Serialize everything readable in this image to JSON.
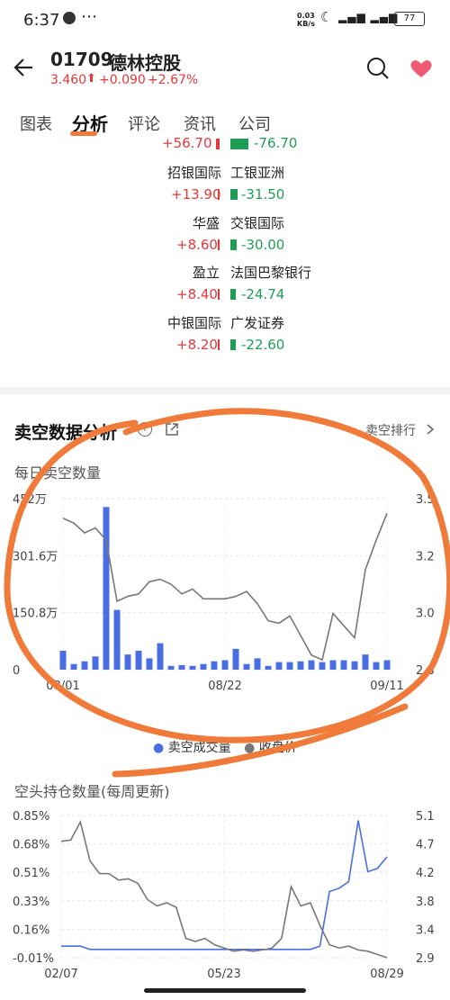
{
  "status_bar": {
    "time": "6:37",
    "net_speed": "0.03\nKB/s",
    "battery": "77"
  },
  "header": {
    "code": "01709",
    "name": "德林控股",
    "price": "3.460",
    "change": "+0.090",
    "change_pct": "+2.67%"
  },
  "tabs": [
    "图表",
    "分析",
    "评论",
    "资讯",
    "公司"
  ],
  "brokers": [
    {
      "buy_name": "",
      "buy_val": "+56.70",
      "sell_name": "",
      "sell_val": "-76.70"
    },
    {
      "buy_name": "招银国际",
      "buy_val": "+13.90",
      "sell_name": "工银亚洲",
      "sell_val": "-31.50"
    },
    {
      "buy_name": "华盛",
      "buy_val": "+8.60",
      "sell_name": "交银国际",
      "sell_val": "-30.00"
    },
    {
      "buy_name": "盈立",
      "buy_val": "+8.40",
      "sell_name": "法国巴黎银行",
      "sell_val": "-24.74"
    },
    {
      "buy_name": "中银国际",
      "buy_val": "+8.20",
      "sell_name": "广发证券",
      "sell_val": "-22.60"
    }
  ],
  "short_section": {
    "title": "卖空数据分析",
    "rank_link": "卖空排行",
    "subtitle": "每日卖空数量"
  },
  "position_section": {
    "subtitle": "空头持仓数量(每周更新)"
  },
  "chart_data": [
    {
      "type": "bar",
      "title": "每日卖空数量",
      "left_ticks": [
        "452万",
        "301.6万",
        "150.8万",
        "0"
      ],
      "right_ticks": [
        "3.5",
        "3.2",
        "3.0",
        "2.8"
      ],
      "x_ticks": [
        "08/01",
        "08/22",
        "09/11"
      ],
      "ylim": [
        0,
        452
      ],
      "y2lim": [
        2.8,
        3.5
      ],
      "series": [
        {
          "name": "卖空成交量",
          "color": "#4a6fe3",
          "values": [
            50,
            15,
            22,
            35,
            430,
            158,
            40,
            50,
            30,
            70,
            10,
            12,
            10,
            15,
            22,
            25,
            55,
            15,
            30,
            10,
            20,
            20,
            22,
            25,
            20,
            25,
            25,
            22,
            40,
            20,
            25
          ]
        },
        {
          "name": "收盘价",
          "color": "#777777",
          "values": [
            3.42,
            3.4,
            3.36,
            3.38,
            3.33,
            3.08,
            3.1,
            3.11,
            3.16,
            3.17,
            3.15,
            3.11,
            3.13,
            3.09,
            3.09,
            3.09,
            3.1,
            3.12,
            3.07,
            3.0,
            2.99,
            3.02,
            2.94,
            2.86,
            2.84,
            3.03,
            2.98,
            2.93,
            3.21,
            3.33,
            3.44
          ]
        }
      ]
    },
    {
      "type": "line",
      "title": "空头持仓数量(每周更新)",
      "left_ticks": [
        "0.85%",
        "0.68%",
        "0.51%",
        "0.33%",
        "0.16%",
        "-0.01%"
      ],
      "right_ticks": [
        "5.1",
        "4.7",
        "4.2",
        "3.8",
        "3.4",
        "2.9"
      ],
      "x_ticks": [
        "02/07",
        "05/23",
        "08/29"
      ],
      "ylim": [
        -0.01,
        0.85
      ],
      "y2lim": [
        2.9,
        5.1
      ],
      "series": [
        {
          "name": "空头持仓",
          "color": "#4a6fe3",
          "values": [
            0.06,
            0.06,
            0.06,
            0.04,
            0.04,
            0.04,
            0.04,
            0.04,
            0.04,
            0.04,
            0.04,
            0.04,
            0.04,
            0.04,
            0.04,
            0.04,
            0.04,
            0.04,
            0.04,
            0.04,
            0.04,
            0.04,
            0.04,
            0.04,
            0.04,
            0.04,
            0.04,
            0.06,
            0.39,
            0.41,
            0.45,
            0.82,
            0.51,
            0.53,
            0.6
          ]
        },
        {
          "name": "收盘价",
          "color": "#777777",
          "values": [
            4.7,
            4.72,
            5.0,
            4.4,
            4.2,
            4.2,
            4.1,
            4.12,
            4.05,
            3.8,
            3.7,
            3.75,
            3.68,
            3.2,
            3.15,
            3.2,
            3.1,
            3.05,
            3.0,
            3.02,
            3.0,
            3.02,
            3.05,
            3.2,
            4.0,
            3.7,
            3.75,
            3.4,
            3.1,
            3.05,
            3.08,
            3.02,
            3.0,
            2.95,
            2.9
          ]
        }
      ]
    }
  ],
  "legend": [
    "卖空成交量",
    "收盘价"
  ]
}
